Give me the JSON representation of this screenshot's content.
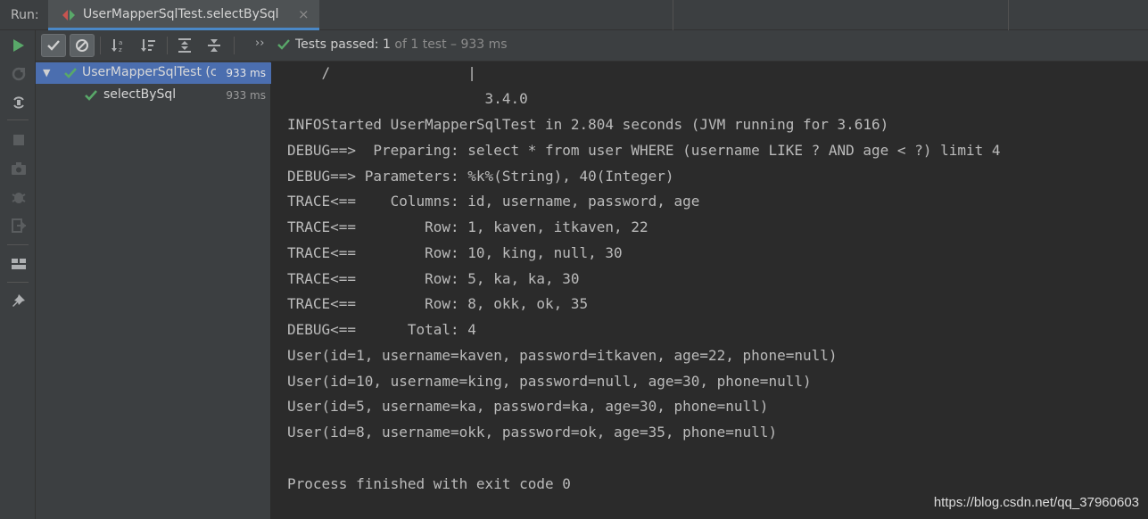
{
  "run_label": "Run:",
  "tab": {
    "title": "UserMapperSqlTest.selectBySql",
    "close": "×"
  },
  "toolbar": {
    "status_main": "Tests passed: 1",
    "status_sub": " of 1 test – 933 ms",
    "chevron": "››"
  },
  "tree": {
    "root": {
      "label": "UserMapperSqlTest (c",
      "time": "933 ms"
    },
    "child": {
      "label": "selectBySql",
      "time": "933 ms"
    }
  },
  "console": {
    "lines": [
      "    /                |",
      "                       3.4.0",
      "INFOStarted UserMapperSqlTest in 2.804 seconds (JVM running for 3.616)",
      "DEBUG==>  Preparing: select * from user WHERE (username LIKE ? AND age < ?) limit 4",
      "DEBUG==> Parameters: %k%(String), 40(Integer)",
      "TRACE<==    Columns: id, username, password, age",
      "TRACE<==        Row: 1, kaven, itkaven, 22",
      "TRACE<==        Row: 10, king, null, 30",
      "TRACE<==        Row: 5, ka, ka, 30",
      "TRACE<==        Row: 8, okk, ok, 35",
      "DEBUG<==      Total: 4",
      "User(id=1, username=kaven, password=itkaven, age=22, phone=null)",
      "User(id=10, username=king, password=null, age=30, phone=null)",
      "User(id=5, username=ka, password=ka, age=30, phone=null)",
      "User(id=8, username=okk, password=ok, age=35, phone=null)",
      "",
      "Process finished with exit code 0"
    ]
  },
  "watermark": "https://blog.csdn.net/qq_37960603",
  "colors": {
    "accent": "#4a88c7",
    "pass_green": "#59a869",
    "selection": "#4b6eaf",
    "console_bg": "#2b2b2b",
    "panel_bg": "#3c3f41"
  },
  "icons": {
    "vertical_toolbar": [
      "rerun-icon",
      "rerun-failed-icon",
      "toggle-auto-test-icon",
      "stop-icon",
      "camera-icon",
      "debug-icon",
      "exit-icon",
      "layout-icon",
      "pin-icon"
    ],
    "test_toolbar": [
      "show-passed-icon",
      "show-ignored-icon",
      "sort-alpha-icon",
      "sort-duration-icon",
      "expand-all-icon",
      "collapse-all-icon"
    ]
  }
}
